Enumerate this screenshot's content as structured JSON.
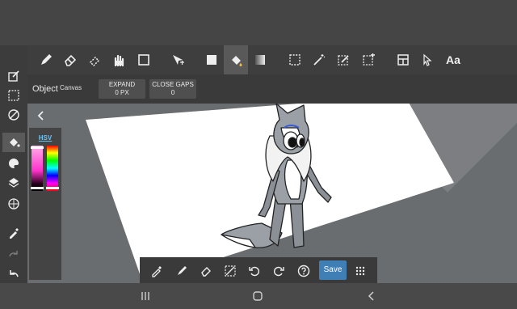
{
  "toolbar": {
    "tools": [
      "pen-icon",
      "eraser-icon",
      "smudge-icon",
      "hand-icon",
      "rectangle-icon",
      "transform-icon",
      "fill-color-icon",
      "bucket-icon",
      "gradient-icon",
      "select-rect-icon",
      "magic-wand-icon",
      "select-pen-icon",
      "select-filter-icon",
      "layout-icon",
      "pointer-icon",
      "text-icon"
    ],
    "text_tool_label": "Aa"
  },
  "options": {
    "object_label": "Object",
    "object_value": "Canvas",
    "expand_label": "EXPAND",
    "expand_value": "0 PX",
    "close_gaps_label": "CLOSE GAPS",
    "close_gaps_value": "0"
  },
  "color_panel": {
    "mode_label": "HSV",
    "current_hue": "#ff33cc"
  },
  "bottom": {
    "save_label": "Save"
  },
  "colors": {
    "accent": "#3f7fb6",
    "canvas": "#ffffff"
  }
}
